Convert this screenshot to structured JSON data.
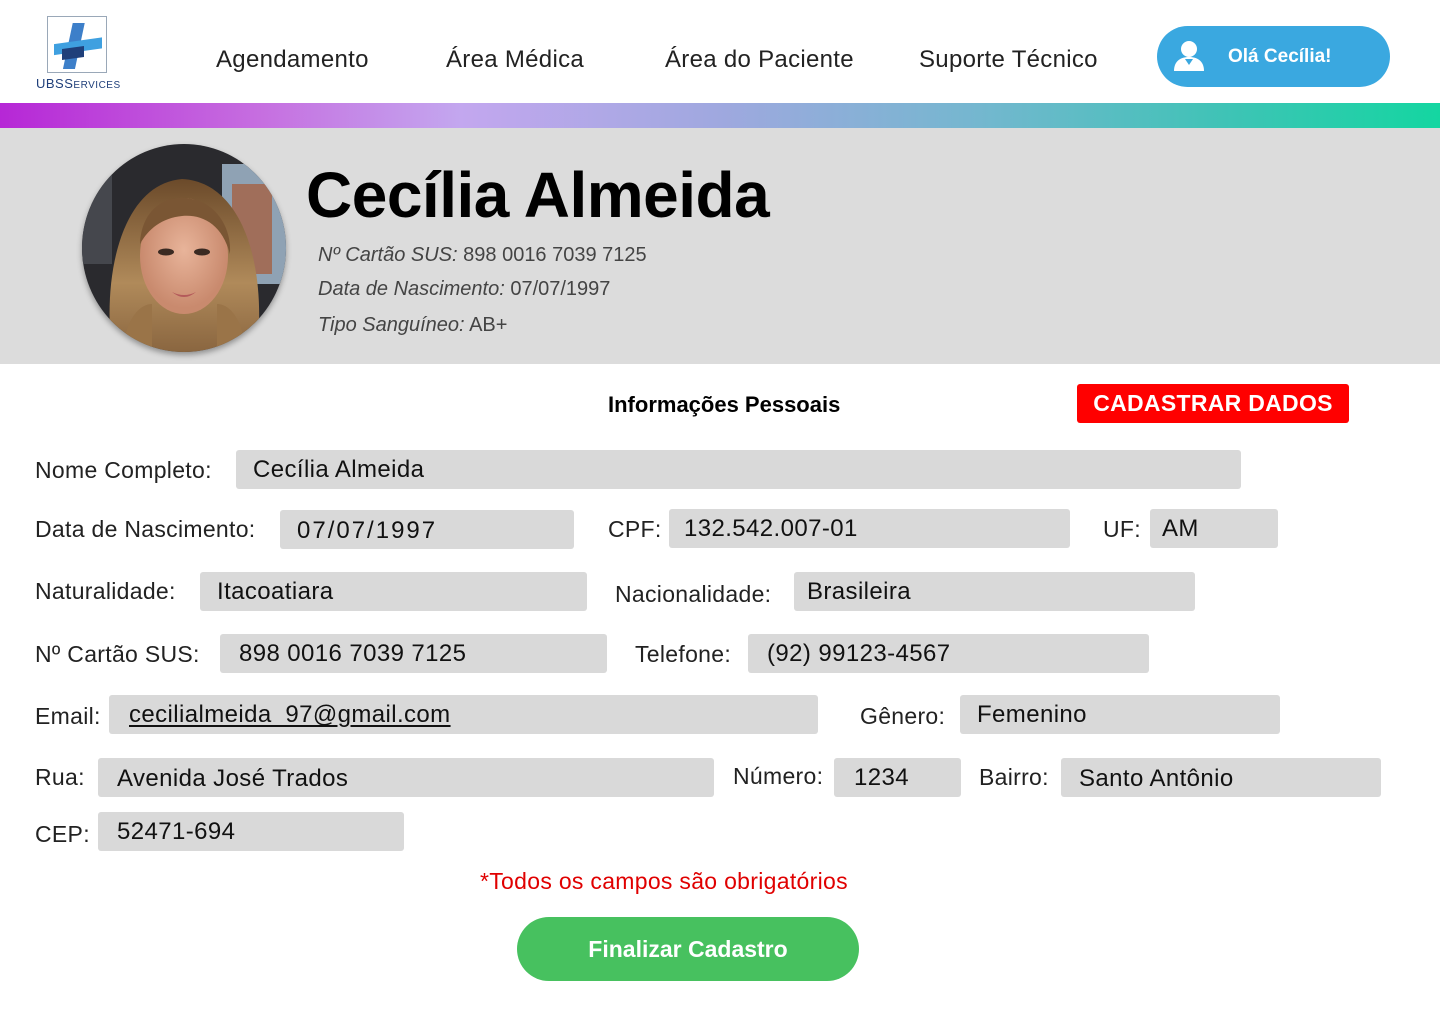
{
  "header": {
    "logo_text_main": "UBS",
    "logo_text_rest": "ERVICES",
    "logo_text_initial": "S",
    "nav": [
      "Agendamento",
      "Área Médica",
      "Área do Paciente",
      "Suporte Técnico"
    ],
    "user_button_label": "Olá Cecília!",
    "user_icon": "user-icon"
  },
  "colors": {
    "accent_blue": "#3aa8e0",
    "alert_red": "#ff0000",
    "confirm_green": "#47c15f"
  },
  "profile": {
    "name": "Cecília Almeida",
    "sus_label": "Nº Cartão SUS:",
    "sus_value": "898 0016 7039 7125",
    "birth_label": "Data de Nascimento:",
    "birth_value": "07/07/1997",
    "blood_label": "Tipo Sanguíneo:",
    "blood_value": "AB+"
  },
  "form": {
    "title": "Informações Pessoais",
    "register_button": "CADASTRAR DADOS",
    "fields": {
      "nome": {
        "label": "Nome Completo:",
        "value": "Cecília Almeida"
      },
      "nascimento": {
        "label": "Data de Nascimento:",
        "value": "07/07/1997"
      },
      "cpf": {
        "label": "CPF:",
        "value": "132.542.007-01"
      },
      "uf": {
        "label": "UF:",
        "value": "AM"
      },
      "naturalidade": {
        "label": "Naturalidade:",
        "value": "Itacoatiara"
      },
      "nacionalidade": {
        "label": "Nacionalidade:",
        "value": "Brasileira"
      },
      "sus": {
        "label": "Nº Cartão SUS:",
        "value": "898 0016 7039 7125"
      },
      "telefone": {
        "label": "Telefone:",
        "value": "(92) 99123-4567"
      },
      "email": {
        "label": "Email:",
        "value": "cecilialmeida_97@gmail.com"
      },
      "genero": {
        "label": "Gênero:",
        "value": "Femenino"
      },
      "rua": {
        "label": "Rua:",
        "value": "Avenida José Trados"
      },
      "numero": {
        "label": "Número:",
        "value": "1234"
      },
      "bairro": {
        "label": "Bairro:",
        "value": "Santo Antônio"
      },
      "cep": {
        "label": "CEP:",
        "value": "52471-694"
      }
    },
    "required_note": "*Todos os campos são obrigatórios",
    "submit_button": "Finalizar Cadastro"
  }
}
